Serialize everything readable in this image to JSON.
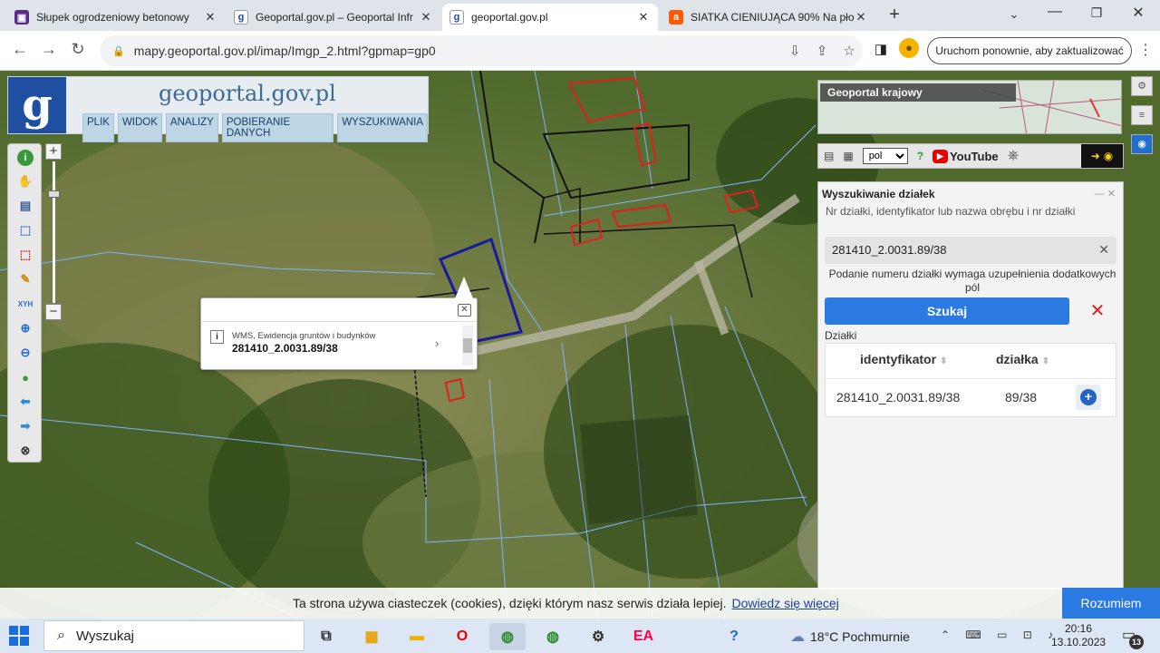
{
  "browser": {
    "tabs": [
      {
        "title": "Słupek ogrodzeniowy betonowy",
        "favicon": "shop-icon",
        "color": "#5b2b8a",
        "active": false
      },
      {
        "title": "Geoportal.gov.pl – Geoportal Infr",
        "favicon": "geoportal-icon",
        "color": "#1f4fa0",
        "active": false
      },
      {
        "title": "geoportal.gov.pl",
        "favicon": "geoportal-icon",
        "color": "#1f4fa0",
        "active": true
      },
      {
        "title": "SIATKA CIENIUJĄCA 90% Na płot",
        "favicon": "allegro-icon",
        "color": "#ff5a00",
        "active": false
      }
    ],
    "url": "mapy.geoportal.gov.pl/imap/Imgp_2.html?gpmap=gp0",
    "restart_label": "Uruchom ponownie, aby zaktualizować"
  },
  "geoportal": {
    "brand": "geoportal.gov.pl",
    "logo_letter": "g",
    "menu": [
      "PLIK",
      "WIDOK",
      "ANALIZY",
      "POBIERANIE DANYCH",
      "WYSZUKIWANIA"
    ],
    "minimap_label": "Geoportal krajowy",
    "lang": "pol",
    "youtube": "YouTube"
  },
  "popup": {
    "layer": "WMS, Ewidencja gruntów i budynków",
    "value": "281410_2.0031.89/38"
  },
  "search_panel": {
    "title": "Wyszukiwanie działek",
    "hint": "Nr działki, identyfikator lub nazwa obrębu i nr działki",
    "value": "281410_2.0031.89/38",
    "note": "Podanie numeru działki wymaga uzupełnienia dodatkowych pól",
    "button": "Szukaj",
    "results_label": "Działki",
    "columns": [
      "identyfikator",
      "działka"
    ],
    "rows": [
      {
        "identyfikator": "281410_2.0031.89/38",
        "dzialka": "89/38"
      }
    ]
  },
  "cookie": {
    "text": "Ta strona używa ciasteczek (cookies), dzięki którym nasz serwis działa lepiej.",
    "link": "Dowiedz się więcej",
    "button": "Rozumiem"
  },
  "taskbar": {
    "search_placeholder": "Wyszukaj",
    "weather": "18°C  Pochmurnie",
    "time": "20:16",
    "date": "13.10.2023",
    "notifications": "13"
  },
  "colors": {
    "accent": "#2a7ae2",
    "parcel_outline": "#7fb3ff",
    "building_outline": "#e02020",
    "selected_parcel": "#1a1a9e"
  }
}
